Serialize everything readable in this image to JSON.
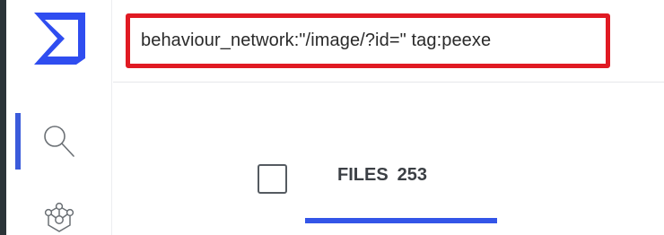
{
  "search": {
    "query": "behaviour_network:\"/image/?id=\" tag:peexe"
  },
  "sidebar": {
    "items": [
      {
        "icon": "search-icon",
        "active": true
      },
      {
        "icon": "graph-icon",
        "active": false
      }
    ]
  },
  "tabs": {
    "files": {
      "label": "FILES",
      "count": "253"
    }
  },
  "colors": {
    "accent": "#3355e8",
    "highlight": "#e01a23",
    "logo": "#2f4df0"
  }
}
